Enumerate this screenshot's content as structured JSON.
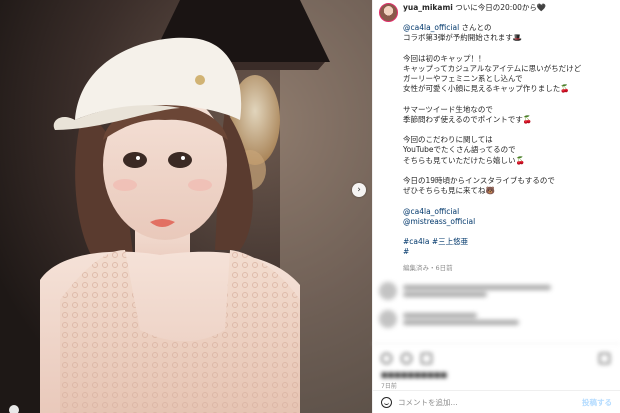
{
  "post": {
    "username": "yua_mikami",
    "headline": "ついに今日の20:00から🖤",
    "caption": {
      "mention_intro": "@ca4la_official",
      "line1_rest": " さんとの",
      "line2": "コラボ第3弾が予約開始されます🎩",
      "line3": "今回は初のキャップ！！",
      "line4": "キャップってカジュアルなアイテムに思いがちだけど",
      "line5": "ガーリーやフェミニン系とし込んで",
      "line6": "女性が可愛く小顔に見えるキャップ作りました🍒",
      "line7": "サマーツイード生地なので",
      "line8": "季節問わず使えるのでポイントです🍒",
      "line9": "今回のこだわりに関しては",
      "line10": "YouTubeでたくさん語ってるので",
      "line11": "そちらも見ていただけたら嬉しい🍒",
      "line12": "今日の19時頃からインスタライブもするので",
      "line13": "ぜひそちらも見に来てね🐻",
      "mention1": "@ca4la_official",
      "mention2": "@mistreass_official",
      "hashtags": "#ca4la #三上悠亜",
      "hash_extra": "#"
    },
    "meta": "編集済み・6日前",
    "date": "7日前"
  },
  "comment_box": {
    "placeholder": "コメントを追加...",
    "post_label": "投稿する"
  },
  "icons": {
    "next": "chevron-right-icon",
    "emoji": "emoji-icon"
  },
  "colors": {
    "link": "#00376b",
    "text": "#262626",
    "muted": "#8e8e8e"
  }
}
